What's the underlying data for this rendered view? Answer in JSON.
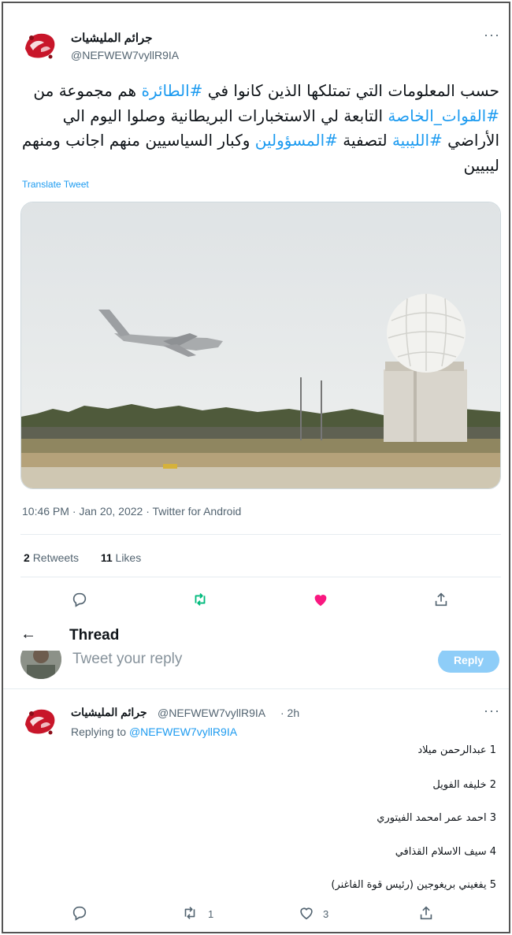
{
  "tweet": {
    "author_name": "جرائم المليشيات",
    "author_handle": "@NEFWEW7vyllR9IA",
    "more": "···",
    "text_parts": [
      {
        "t": "حسب المعلومات التي تمتلكها الذين كانوا في ",
        "tag": false
      },
      {
        "t": "#الطائرة",
        "tag": true
      },
      {
        "t": " هم مجموعة من ",
        "tag": false
      },
      {
        "t": "#القوات_الخاصة",
        "tag": true
      },
      {
        "t": " التابعة لي الاستخبارات البريطانية وصلوا اليوم الي الأراضي ",
        "tag": false
      },
      {
        "t": "#الليبية",
        "tag": true
      },
      {
        "t": " لتصفية ",
        "tag": false
      },
      {
        "t": "#المسؤولين",
        "tag": true
      },
      {
        "t": "  وكبار السياسيين منهم اجانب ومنهم ليبيين",
        "tag": false
      }
    ],
    "translate": "Translate Tweet",
    "meta": "10:46 PM · Jan 20, 2022 · Twitter for Android",
    "retweets_count": "2",
    "retweets_label": "Retweets",
    "likes_count": "11",
    "likes_label": "Likes"
  },
  "thread": {
    "back": "←",
    "title": "Thread",
    "reply_placeholder": "Tweet your reply",
    "reply_button": "Reply"
  },
  "reply": {
    "author_name": "جرائم المليشيات",
    "author_handle": "@NEFWEW7vyllR9IA",
    "time": "· 2h",
    "more": "···",
    "replying_prefix": "Replying to",
    "replying_to": "@NEFWEW7vyllR9IA",
    "items": [
      "1 عبدالرحمن ميلاد",
      "2 خليفه الفويل",
      "3 احمد عمر امحمد الفيتوري",
      "4 سيف الاسلام القذافي",
      "5 يفغيني بريغوجين (رئيس قوة الفاغنر)"
    ],
    "retweet_count": "1",
    "like_count": "3"
  },
  "colors": {
    "accent": "#1d9bf0",
    "retweet_active": "#00ba7c",
    "like_active": "#f91880",
    "muted": "#536471"
  },
  "icons": [
    "reply-icon",
    "retweet-icon",
    "heart-icon",
    "share-icon",
    "back-arrow-icon",
    "more-icon"
  ]
}
